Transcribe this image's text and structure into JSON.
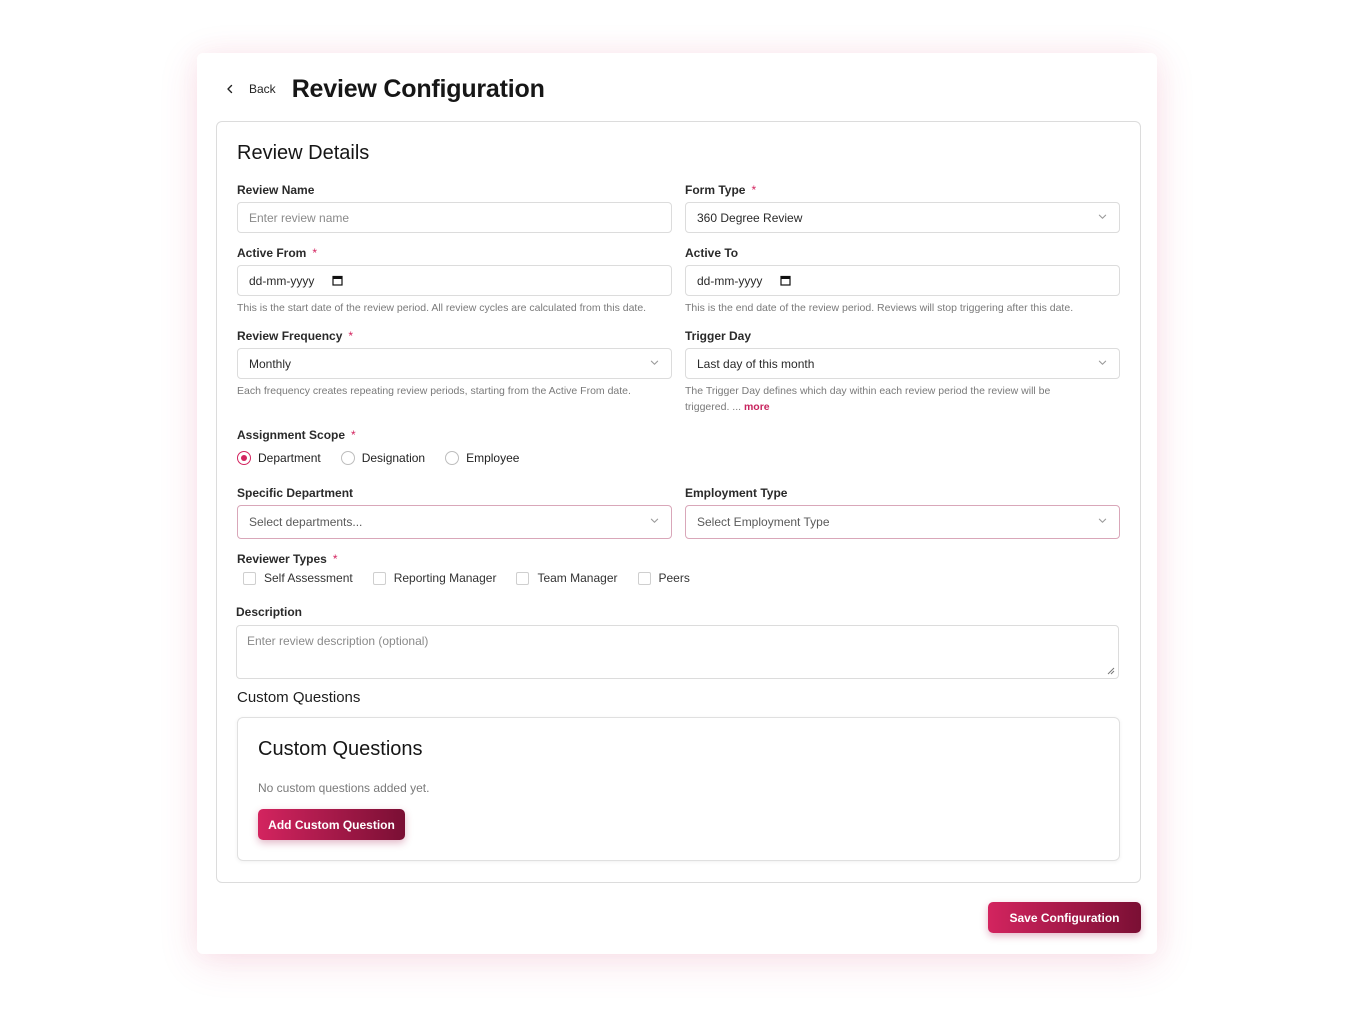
{
  "header": {
    "back_label": "Back",
    "title": "Review Configuration"
  },
  "details": {
    "section_title": "Review Details",
    "review_name": {
      "label": "Review Name",
      "placeholder": "Enter review name",
      "value": ""
    },
    "form_type": {
      "label": "Form Type",
      "required": "*",
      "value": "360 Degree Review"
    },
    "active_from": {
      "label": "Active From",
      "required": "*",
      "value": "dd-mm-yyyy",
      "help": "This is the start date of the review period. All review cycles are calculated from this date."
    },
    "active_to": {
      "label": "Active To",
      "value": "dd-mm-yyyy",
      "help": "This is the end date of the review period. Reviews will stop triggering after this date."
    },
    "review_frequency": {
      "label": "Review Frequency",
      "required": "*",
      "value": "Monthly",
      "help": "Each frequency creates repeating review periods, starting from the Active From date."
    },
    "trigger_day": {
      "label": "Trigger Day",
      "value": "Last day of this month",
      "help_line1": "The Trigger Day defines which day within each review period the review will be",
      "help_line2": "triggered. ...",
      "more": "more"
    },
    "assignment_scope": {
      "label": "Assignment Scope",
      "required": "*",
      "options": [
        "Department",
        "Designation",
        "Employee"
      ],
      "selected": "Department"
    },
    "specific_department": {
      "label": "Specific Department",
      "placeholder": "Select departments..."
    },
    "employment_type": {
      "label": "Employment Type",
      "placeholder": "Select Employment Type"
    },
    "reviewer_types": {
      "label": "Reviewer Types",
      "required": "*",
      "options": [
        "Self Assessment",
        "Reporting Manager",
        "Team Manager",
        "Peers"
      ]
    },
    "description": {
      "label": "Description",
      "placeholder": "Enter review description (optional)"
    },
    "custom_questions": {
      "heading": "Custom Questions",
      "card_title": "Custom Questions",
      "empty_text": "No custom questions added yet.",
      "add_button": "Add Custom Question"
    }
  },
  "save_button": "Save Configuration",
  "colors": {
    "accent": "#d3245f",
    "accent_dark": "#7a0f34"
  },
  "icons": [
    "chevron-left-icon",
    "chevron-down-icon",
    "calendar-icon",
    "resize-handle-icon"
  ]
}
